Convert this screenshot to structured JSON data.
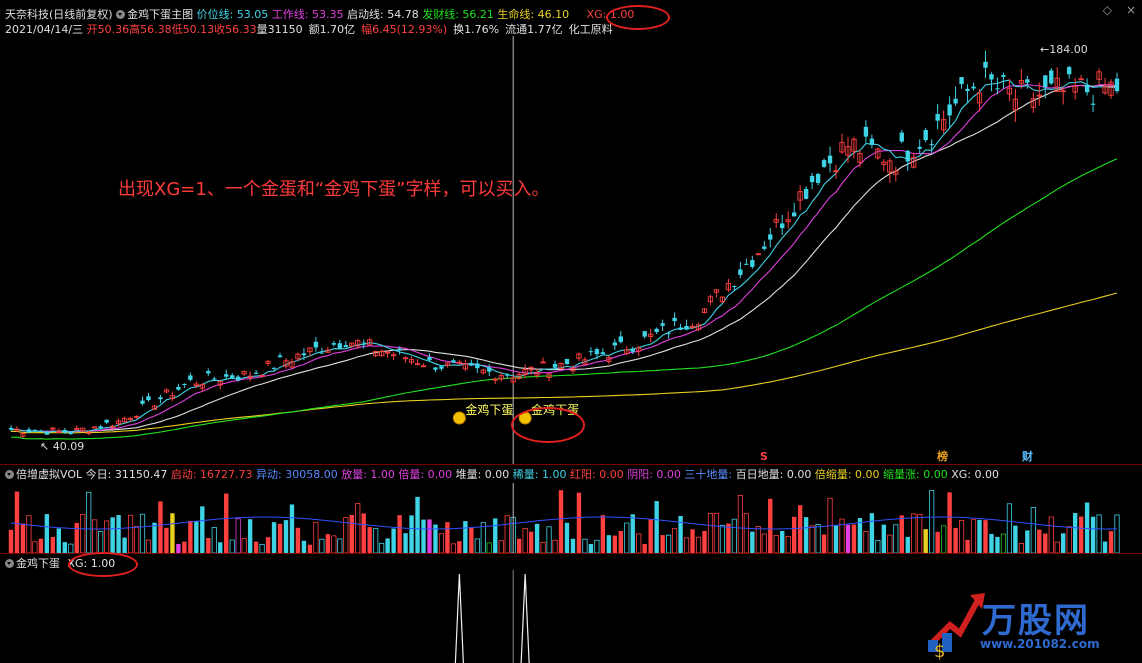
{
  "main": {
    "name": "天奈科技",
    "mode": "(日线前复权)",
    "indicator": "金鸡下蛋主图",
    "items": [
      {
        "label": "价位线:",
        "value": "53.05",
        "color": "#3fd3e6"
      },
      {
        "label": "工作线:",
        "value": "53.35",
        "color": "#e040e0"
      },
      {
        "label": "启动线:",
        "value": "54.78",
        "color": "#e0e0e0"
      },
      {
        "label": "发财线:",
        "value": "56.21",
        "color": "#20e020"
      },
      {
        "label": "生命线:",
        "value": "46.10",
        "color": "#e8d020"
      }
    ],
    "xg": "XG: 1.00"
  },
  "quote": {
    "date": "2021/04/14/三",
    "open_label": "开",
    "open": "50.36",
    "high_label": "高",
    "high": "56.38",
    "low_label": "低",
    "low": "50.13",
    "close_label": "收",
    "close": "56.33",
    "vol_label": "量",
    "vol": "31150",
    "amt_label": "额",
    "amt": "1.70亿",
    "chg_label": "幅",
    "chg": "6.45(12.93%)",
    "turn_label": "换",
    "turn": "1.76%",
    "float_label": "流通",
    "float": "1.77亿",
    "sector": "化工原料"
  },
  "annotation": "出现XG=1、一个金蛋和“金鸡下蛋”字样，可以买入。",
  "price_max_label": "184.00",
  "price_min_label": "40.09",
  "egg_label": "金鸡下蛋",
  "event_tags": [
    "S",
    "榜",
    "财"
  ],
  "vol_panel": {
    "title": "倍增虚拟VOL",
    "items": [
      {
        "label": "今日:",
        "value": "31150.47",
        "color": "#e0e0e0"
      },
      {
        "label": "启动:",
        "value": "16727.73",
        "color": "#ff4040"
      },
      {
        "label": "异动:",
        "value": "30058.00",
        "color": "#5a8cff"
      },
      {
        "label": "放量:",
        "value": "1.00",
        "color": "#e040e0"
      },
      {
        "label": "倍量:",
        "value": "0.00",
        "color": "#e040e0"
      },
      {
        "label": "堆量:",
        "value": "0.00",
        "color": "#e0e0e0"
      },
      {
        "label": "稀量:",
        "value": "1.00",
        "color": "#3fd3e6"
      },
      {
        "label": "红阳:",
        "value": "0.00",
        "color": "#ff4040"
      },
      {
        "label": "阴阳:",
        "value": "0.00",
        "color": "#e040e0"
      },
      {
        "label": "三十地量:",
        "value": "",
        "color": "#5a8cff"
      },
      {
        "label": "百日地量:",
        "value": "0.00",
        "color": "#e0e0e0"
      },
      {
        "label": "倍缩量:",
        "value": "0.00",
        "color": "#e8d020"
      },
      {
        "label": "缩量涨:",
        "value": "0.00",
        "color": "#20e020"
      },
      {
        "label": "XG:",
        "value": "0.00",
        "color": "#e0e0e0"
      }
    ]
  },
  "xg_panel": {
    "title": "金鸡下蛋",
    "xg": "XG: 1.00"
  },
  "watermark": {
    "brand": "万股网",
    "url": "www.201082.com"
  },
  "colors": {
    "up": "#ff4040",
    "down": "#3fd3e6",
    "ma5": "#3fd3e6",
    "ma10": "#e040e0",
    "ma20": "#e0e0e0",
    "ma60": "#20e020",
    "ma120": "#e8d020"
  },
  "chart_data": {
    "type": "candlestick",
    "ylim": [
      40.09,
      184.0
    ],
    "candles": {
      "count": 186,
      "crosshair_index": 84,
      "egg_indices": [
        75,
        86
      ],
      "xg_spike_indices": [
        75,
        86
      ]
    }
  }
}
